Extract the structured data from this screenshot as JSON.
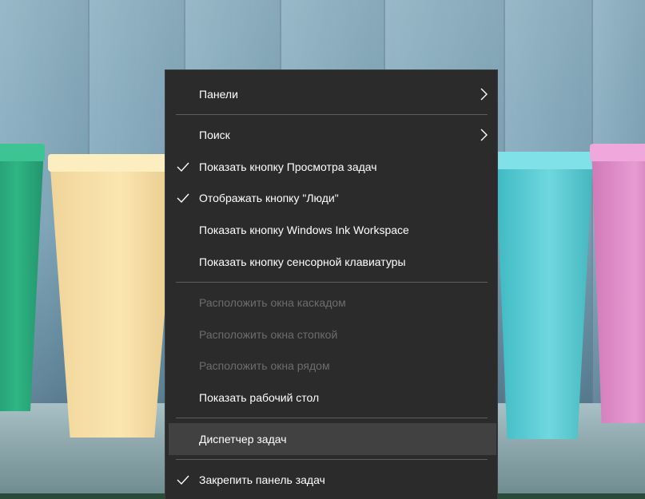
{
  "context_menu": {
    "items": [
      {
        "label": "Панели",
        "checked": false,
        "submenu": true,
        "disabled": false
      },
      {
        "label": "Поиск",
        "checked": false,
        "submenu": true,
        "disabled": false
      },
      {
        "label": "Показать кнопку Просмотра задач",
        "checked": true,
        "submenu": false,
        "disabled": false
      },
      {
        "label": "Отображать кнопку \"Люди\"",
        "checked": true,
        "submenu": false,
        "disabled": false
      },
      {
        "label": "Показать кнопку Windows Ink Workspace",
        "checked": false,
        "submenu": false,
        "disabled": false
      },
      {
        "label": "Показать кнопку сенсорной клавиатуры",
        "checked": false,
        "submenu": false,
        "disabled": false
      },
      {
        "label": "Расположить окна каскадом",
        "checked": false,
        "submenu": false,
        "disabled": true
      },
      {
        "label": "Расположить окна стопкой",
        "checked": false,
        "submenu": false,
        "disabled": true
      },
      {
        "label": "Расположить окна рядом",
        "checked": false,
        "submenu": false,
        "disabled": true
      },
      {
        "label": "Показать рабочий стол",
        "checked": false,
        "submenu": false,
        "disabled": false
      },
      {
        "label": "Диспетчер задач",
        "checked": false,
        "submenu": false,
        "disabled": false,
        "highlighted": true
      },
      {
        "label": "Закрепить панель задач",
        "checked": true,
        "submenu": false,
        "disabled": false
      }
    ]
  },
  "colors": {
    "menu_background": "#2b2b2b",
    "menu_text": "#ffffff",
    "menu_disabled_text": "#6d6d6d",
    "menu_highlight": "#414141",
    "separator": "#5d5d5d"
  },
  "icons": {
    "check": "checkmark-icon",
    "submenu_arrow": "chevron-right-icon"
  }
}
